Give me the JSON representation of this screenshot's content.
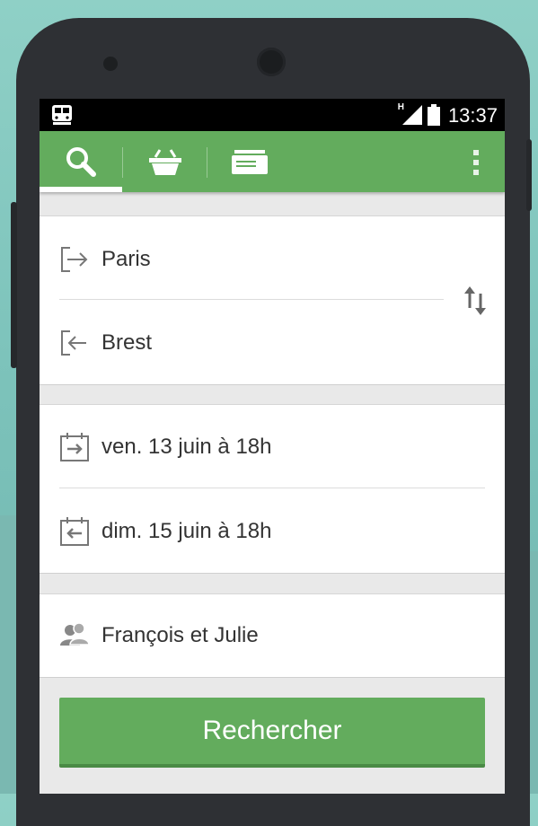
{
  "status_bar": {
    "time": "13:37",
    "network_label": "H",
    "icons": [
      "train-icon",
      "signal-icon",
      "battery-icon"
    ]
  },
  "toolbar": {
    "tabs": [
      {
        "name": "search",
        "icon": "search-icon",
        "active": true
      },
      {
        "name": "basket",
        "icon": "basket-icon",
        "active": false
      },
      {
        "name": "tickets",
        "icon": "ticket-icon",
        "active": false
      }
    ],
    "menu_icon": "overflow-menu-icon"
  },
  "route": {
    "origin": "Paris",
    "destination": "Brest",
    "origin_icon": "departure-icon",
    "destination_icon": "arrival-icon",
    "swap_icon": "swap-icon"
  },
  "dates": {
    "outbound": "ven. 13 juin à 18h",
    "return": "dim. 15 juin à 18h",
    "outbound_icon": "calendar-outbound-icon",
    "return_icon": "calendar-return-icon"
  },
  "passengers": {
    "label": "François et Julie",
    "icon": "passengers-icon"
  },
  "search_button": {
    "label": "Rechercher"
  },
  "colors": {
    "accent": "#63ac5d",
    "status_bar": "#000000",
    "phone_body": "#2e3034",
    "background": "#8fd0c6"
  }
}
